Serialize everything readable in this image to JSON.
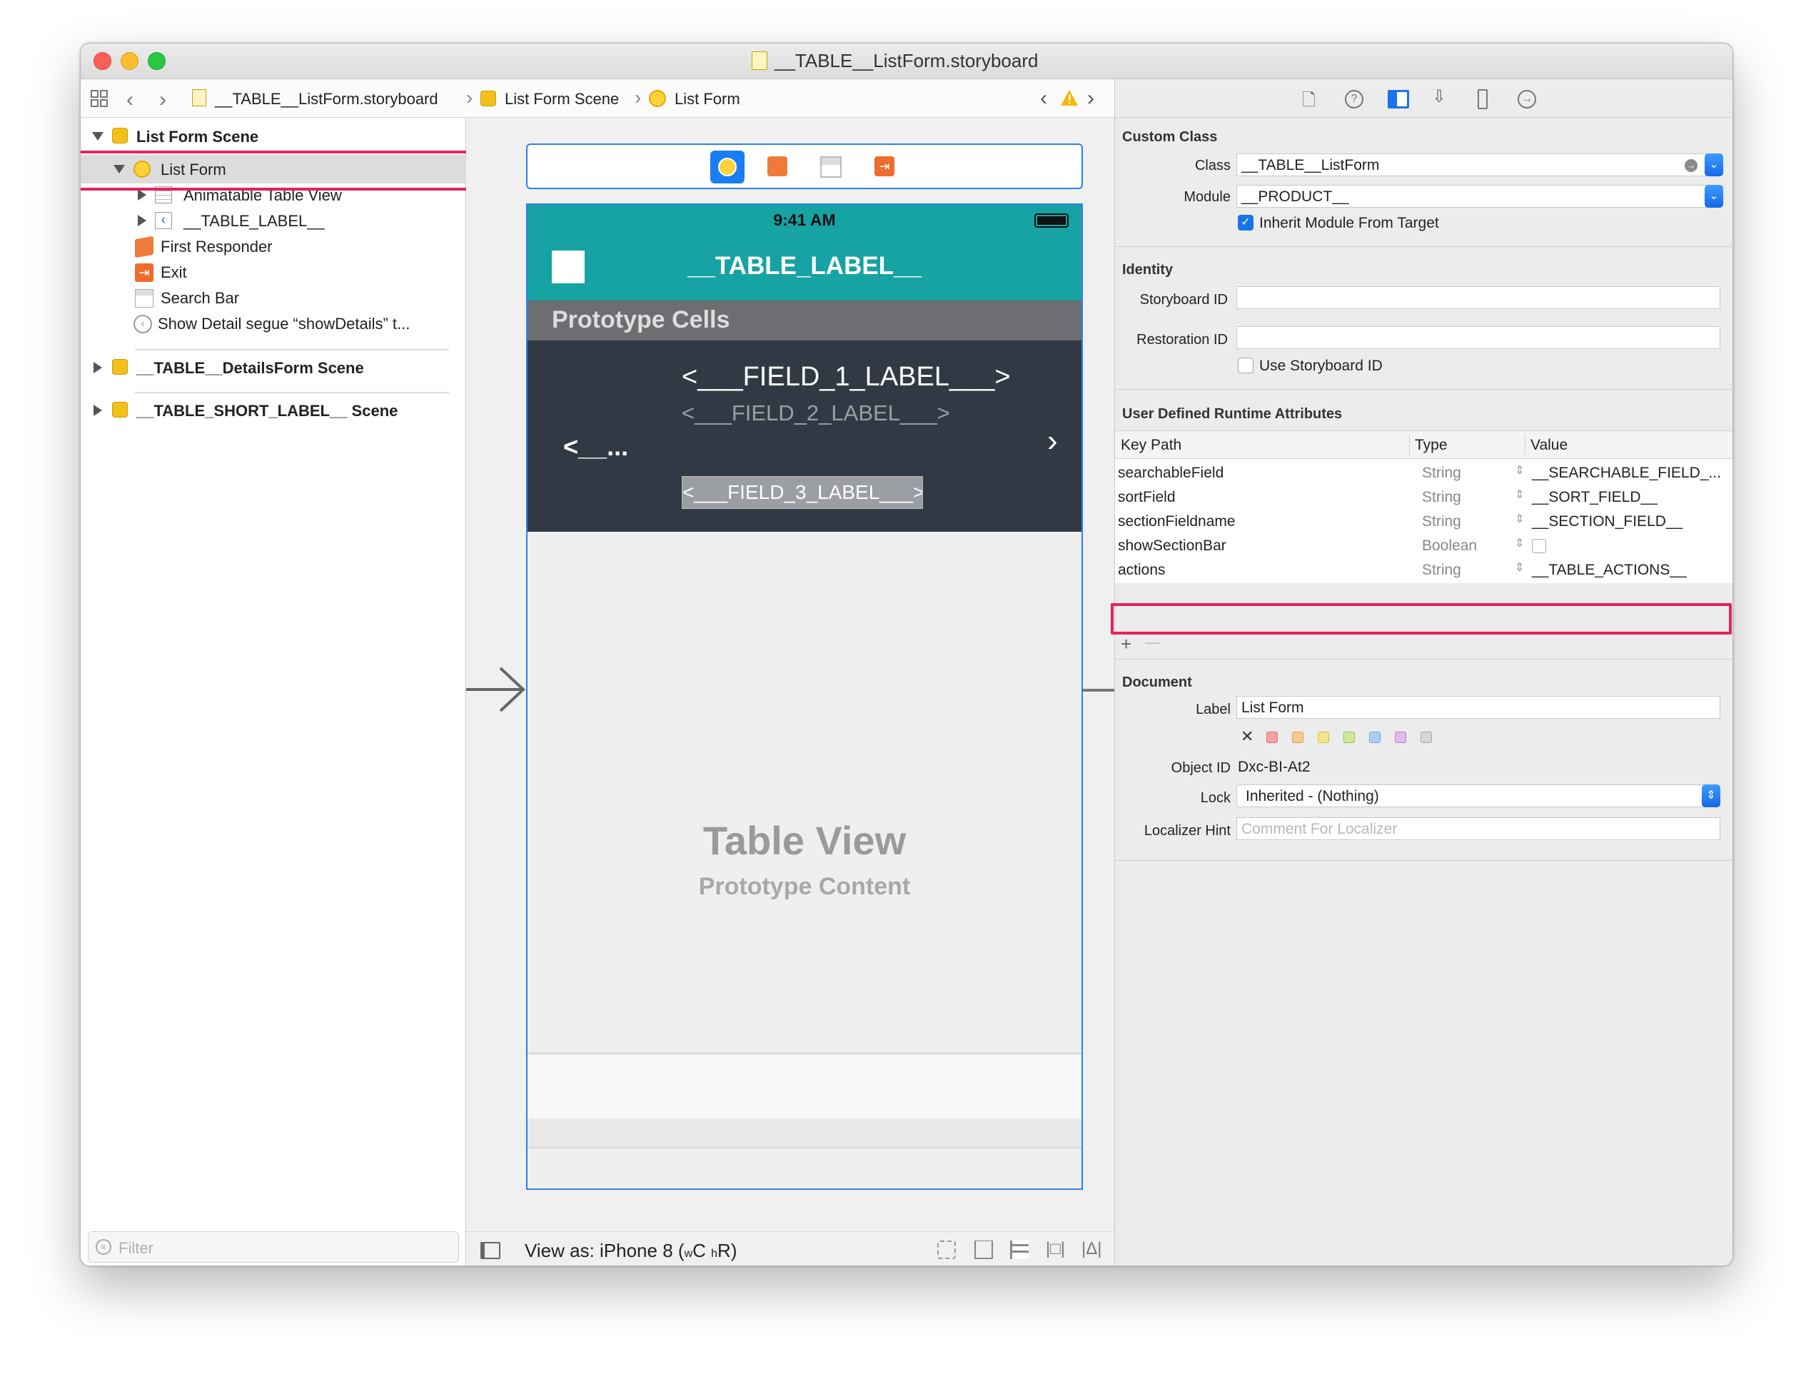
{
  "window": {
    "title": "__TABLE__ListForm.storyboard"
  },
  "nav": {
    "crumb_file": "__TABLE__ListForm.storyboard",
    "crumb_scene": "List Form Scene",
    "crumb_controller": "List Form"
  },
  "outline": {
    "scene1": "List Form Scene",
    "list_form": "List Form",
    "animatable_table_view": "Animatable Table View",
    "table_label": "__TABLE_LABEL__",
    "first_responder": "First Responder",
    "exit": "Exit",
    "search_bar": "Search Bar",
    "segue": "Show Detail segue “showDetails” t...",
    "scene2": "__TABLE__DetailsForm Scene",
    "scene3": "__TABLE_SHORT_LABEL__ Scene",
    "filter_placeholder": "Filter"
  },
  "device": {
    "time": "9:41 AM",
    "nav_title": "__TABLE_LABEL__",
    "prototype_cells": "Prototype Cells",
    "field1": "<___FIELD_1_LABEL___>",
    "field2": "<___FIELD_2_LABEL___>",
    "left_label": "<__...",
    "field3": "<___FIELD_3_LABEL___>",
    "table_view_title": "Table View",
    "table_view_sub": "Prototype Content"
  },
  "bottom_bar": {
    "view_as": "View as: iPhone 8",
    "size_w": "w",
    "size_c": "C",
    "size_h": "h",
    "size_r": "R"
  },
  "inspector": {
    "custom_class": {
      "title": "Custom Class",
      "class_label": "Class",
      "class_value": "__TABLE__ListForm",
      "module_label": "Module",
      "module_value": "__PRODUCT__",
      "inherit_label": "Inherit Module From Target"
    },
    "identity": {
      "title": "Identity",
      "storyboard_id_label": "Storyboard ID",
      "restoration_id_label": "Restoration ID",
      "use_storyboard_label": "Use Storyboard ID"
    },
    "runtime": {
      "title": "User Defined Runtime Attributes",
      "col_key": "Key Path",
      "col_type": "Type",
      "col_value": "Value",
      "rows": [
        {
          "key": "searchableField",
          "type": "String",
          "value": "__SEARCHABLE_FIELD_..."
        },
        {
          "key": "sortField",
          "type": "String",
          "value": "__SORT_FIELD__"
        },
        {
          "key": "sectionFieldname",
          "type": "String",
          "value": "__SECTION_FIELD__"
        },
        {
          "key": "showSectionBar",
          "type": "Boolean",
          "value": ""
        },
        {
          "key": "actions",
          "type": "String",
          "value": "__TABLE_ACTIONS__"
        }
      ],
      "add": "+",
      "remove": "—"
    },
    "document": {
      "title": "Document",
      "label_label": "Label",
      "label_value": "List Form",
      "object_id_label": "Object ID",
      "object_id_value": "Dxc-BI-At2",
      "lock_label": "Lock",
      "lock_value": "Inherited - (Nothing)",
      "hint_label": "Localizer Hint",
      "hint_placeholder": "Comment For Localizer"
    }
  },
  "colors": {
    "teal": "#17a2a3",
    "dark_cell": "#313a44",
    "selection_red": "#e5235a",
    "accent_blue": "#1a73e8"
  }
}
